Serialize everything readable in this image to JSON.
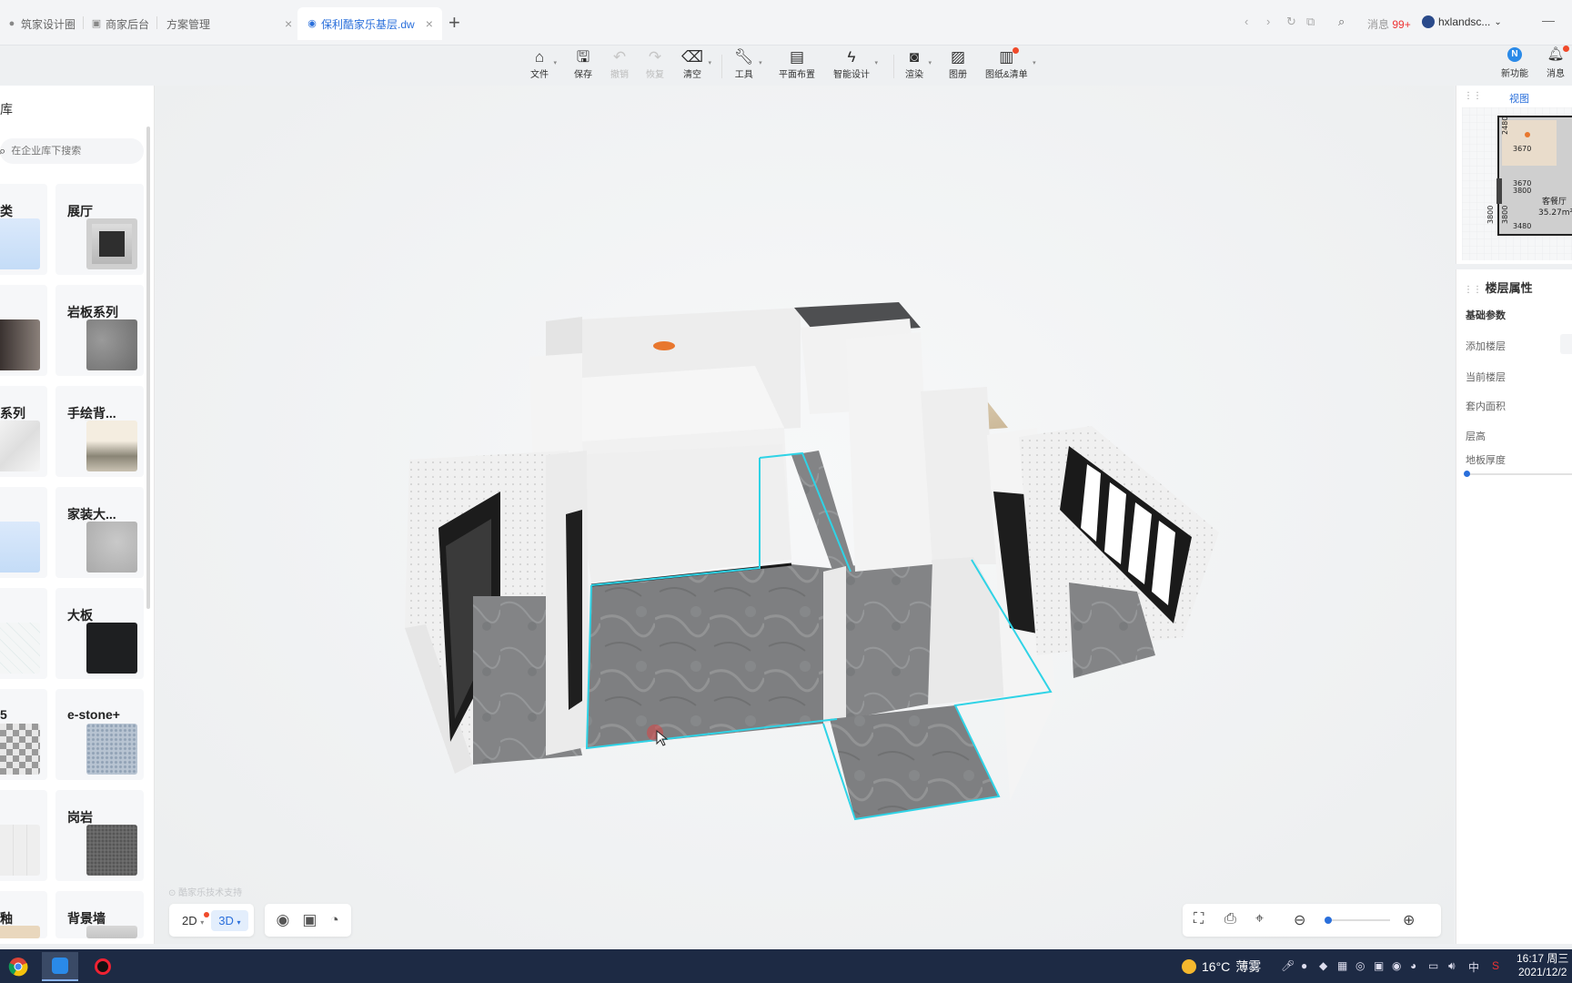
{
  "tabs": [
    {
      "label": "筑家设计圈",
      "icon": "globe-icon"
    },
    {
      "label": "商家后台",
      "icon": "page-icon"
    },
    {
      "label": "方案管理",
      "icon": ""
    },
    {
      "label": "保利酷家乐基层.dw",
      "icon": "app-icon",
      "active": true
    }
  ],
  "browser": {
    "messages_label": "消息",
    "messages_count": "99+",
    "username": "hxlandsc..."
  },
  "toolbar": {
    "items": [
      {
        "label": "文件",
        "icon": "home-icon"
      },
      {
        "label": "保存",
        "icon": "save-icon"
      },
      {
        "label": "撤销",
        "icon": "undo-icon"
      },
      {
        "label": "恢复",
        "icon": "redo-icon"
      },
      {
        "label": "清空",
        "icon": "eraser-icon"
      },
      {
        "label": "工具",
        "icon": "wrench-icon"
      },
      {
        "label": "平面布置",
        "icon": "layout-icon"
      },
      {
        "label": "智能设计",
        "icon": "lightning-icon"
      },
      {
        "label": "渲染",
        "icon": "camera-icon"
      },
      {
        "label": "图册",
        "icon": "album-icon"
      },
      {
        "label": "图纸&清单",
        "icon": "drawing-list-icon"
      }
    ]
  },
  "right_top": {
    "new_features_label": "新功能",
    "messages_label": "消息"
  },
  "library": {
    "title": "库",
    "search_placeholder": "在企业库下搜索",
    "left_column": [
      "类",
      "",
      "系列",
      "",
      "",
      "5",
      "",
      "釉"
    ],
    "right_column": [
      "展厅",
      "岩板系列",
      "手绘背...",
      "家装大...",
      "大板",
      "e-stone+",
      "岗岩",
      "背景墙"
    ]
  },
  "viewport": {
    "watermark": "酷家乐技术支持",
    "view_2d": "2D",
    "view_3d": "3D"
  },
  "minimap": {
    "title": "视图",
    "dims": [
      "3670",
      "3670",
      "3800",
      "3480",
      "3800",
      "3800",
      "2480"
    ],
    "room_name": "客餐厅",
    "room_area": "35.27m²"
  },
  "floor_props": {
    "title": "楼层属性",
    "section": "基础参数",
    "rows": [
      "添加楼层",
      "当前楼层",
      "套内面积",
      "层高",
      "地板厚度"
    ]
  },
  "taskbar": {
    "temperature": "16°C",
    "weather": "薄雾",
    "ime": "中",
    "time": "16:17 周三",
    "date": "2021/12/2"
  },
  "colors": {
    "accent": "#2a6fdb",
    "highlight_outline": "#2fd3e6",
    "badge": "#f04a2a",
    "taskbar": "#1d2a44"
  }
}
